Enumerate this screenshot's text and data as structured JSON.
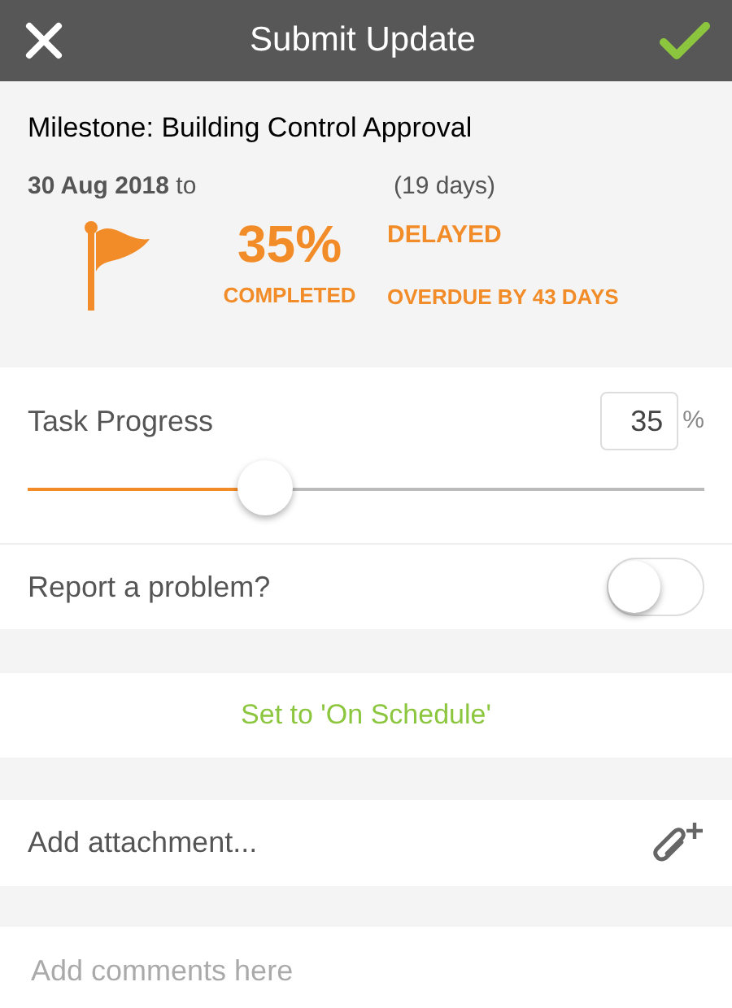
{
  "header": {
    "title": "Submit Update"
  },
  "milestone": {
    "title": "Milestone: Building Control Approval",
    "dates": "**30 Aug 2018** to",
    "duration": "(19 days)",
    "percent": "35%",
    "percent_label": "COMPLETED",
    "status": "DELAYED",
    "overdue": "OVERDUE BY 43 DAYS"
  },
  "progress": {
    "label": "Task Progress",
    "value": "35",
    "unit": "%",
    "level": 0.35
  },
  "problem": {
    "label": "Report a problem?",
    "on": false
  },
  "schedule_button": "Set to 'On Schedule'",
  "attachment": {
    "label": "Add attachment..."
  },
  "comments": {
    "placeholder": "Add comments here"
  }
}
